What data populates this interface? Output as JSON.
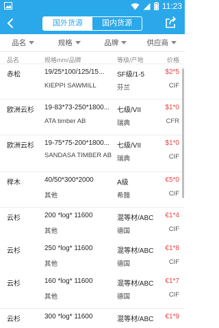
{
  "status_bar": {
    "time": "11:23",
    "colors": {
      "bar": "#2aa8ea"
    }
  },
  "header": {
    "tabs": [
      {
        "label": "国外货源",
        "active": true
      },
      {
        "label": "国内货源",
        "active": false
      }
    ]
  },
  "filters": [
    {
      "label": "品名"
    },
    {
      "label": "规格"
    },
    {
      "label": "品牌"
    },
    {
      "label": "供应商"
    }
  ],
  "columns": {
    "name": "品名",
    "spec": "规格mm/品牌",
    "grade": "等级/产地",
    "price": "价格"
  },
  "rows": [
    {
      "name": "赤松",
      "spec": "19/25*100/125/15...",
      "brand": "KIEPPI SAWMILL",
      "grade": "SF级/1-5",
      "origin": "芬兰",
      "price": "$2*5",
      "term": "CIF"
    },
    {
      "name": "欧洲云杉",
      "spec": "19-83*73-250*1800...",
      "brand": "ATA timber AB",
      "grade": "七级/VII",
      "origin": "瑞典",
      "price": "$1*0",
      "term": "CFR"
    },
    {
      "name": "欧洲云杉",
      "spec": "19-75*75-200*1800...",
      "brand": "SANDASA TIMBER AB",
      "grade": "七级/VII",
      "origin": "瑞典",
      "price": "$1*0",
      "term": "CIF"
    },
    {
      "name": "榉木",
      "spec": "40/50*300*2000",
      "brand": "其他",
      "grade": "A级",
      "origin": "希腊",
      "price": "€5*0",
      "term": "CIF"
    },
    {
      "name": "云杉",
      "spec": "200 *log* 11600",
      "brand": "其他",
      "grade": "混等材/ABC",
      "origin": "德国",
      "price": "€1*4",
      "term": "CIF"
    },
    {
      "name": "云杉",
      "spec": "250 *log* 11600",
      "brand": "其他",
      "grade": "混等材/ABC",
      "origin": "德国",
      "price": "€1*8",
      "term": "CIF"
    },
    {
      "name": "云杉",
      "spec": "160 *log* 11600",
      "brand": "其他",
      "grade": "混等材/ABC",
      "origin": "德国",
      "price": "€1*7",
      "term": "CIF"
    },
    {
      "name": "云杉",
      "spec": "300 *log* 11600",
      "brand": "",
      "grade": "混等材/ABC",
      "origin": "",
      "price": "€1*9",
      "term": ""
    }
  ]
}
